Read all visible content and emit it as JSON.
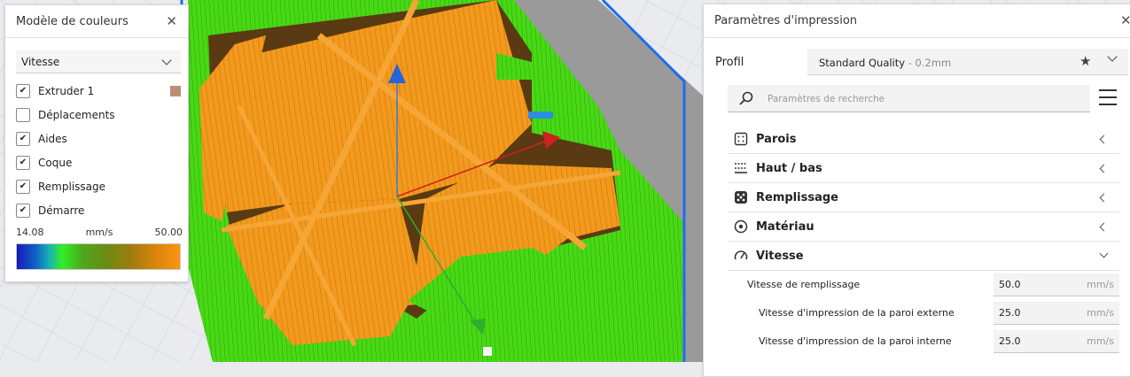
{
  "color_scheme": {
    "title": "Modèle de couleurs",
    "mode": "Vitesse",
    "items": [
      {
        "label": "Extruder 1",
        "checked": true,
        "swatch": "#b88f73"
      },
      {
        "label": "Déplacements",
        "checked": false
      },
      {
        "label": "Aides",
        "checked": true
      },
      {
        "label": "Coque",
        "checked": true
      },
      {
        "label": "Remplissage",
        "checked": true
      },
      {
        "label": "Démarre",
        "checked": true
      }
    ],
    "range": {
      "min": "14.08",
      "unit": "mm/s",
      "max": "50.00"
    }
  },
  "print_settings": {
    "title": "Paramètres d'impression",
    "profile_label": "Profil",
    "profile_name": "Standard Quality",
    "profile_layer": " - 0.2mm",
    "search_placeholder": "Paramètres de recherche",
    "categories": [
      {
        "label": "Parois",
        "icon": "walls-icon",
        "expanded": false
      },
      {
        "label": "Haut / bas",
        "icon": "top-bottom-icon",
        "expanded": false
      },
      {
        "label": "Remplissage",
        "icon": "infill-icon",
        "expanded": false
      },
      {
        "label": "Matériau",
        "icon": "material-icon",
        "expanded": false
      },
      {
        "label": "Vitesse",
        "icon": "speed-icon",
        "expanded": true
      }
    ],
    "speed_settings": [
      {
        "label": "Vitesse de remplissage",
        "value": "50.0",
        "unit": "mm/s"
      },
      {
        "label": "Vitesse d'impression de la paroi externe",
        "value": "25.0",
        "unit": "mm/s"
      },
      {
        "label": "Vitesse d'impression de la paroi interne",
        "value": "25.0",
        "unit": "mm/s"
      }
    ]
  },
  "colors": {
    "viewport_bg": "#e9ebee",
    "model_orange": "#f39a1e",
    "model_green": "#48d915",
    "accent": "#0a6cf0"
  }
}
